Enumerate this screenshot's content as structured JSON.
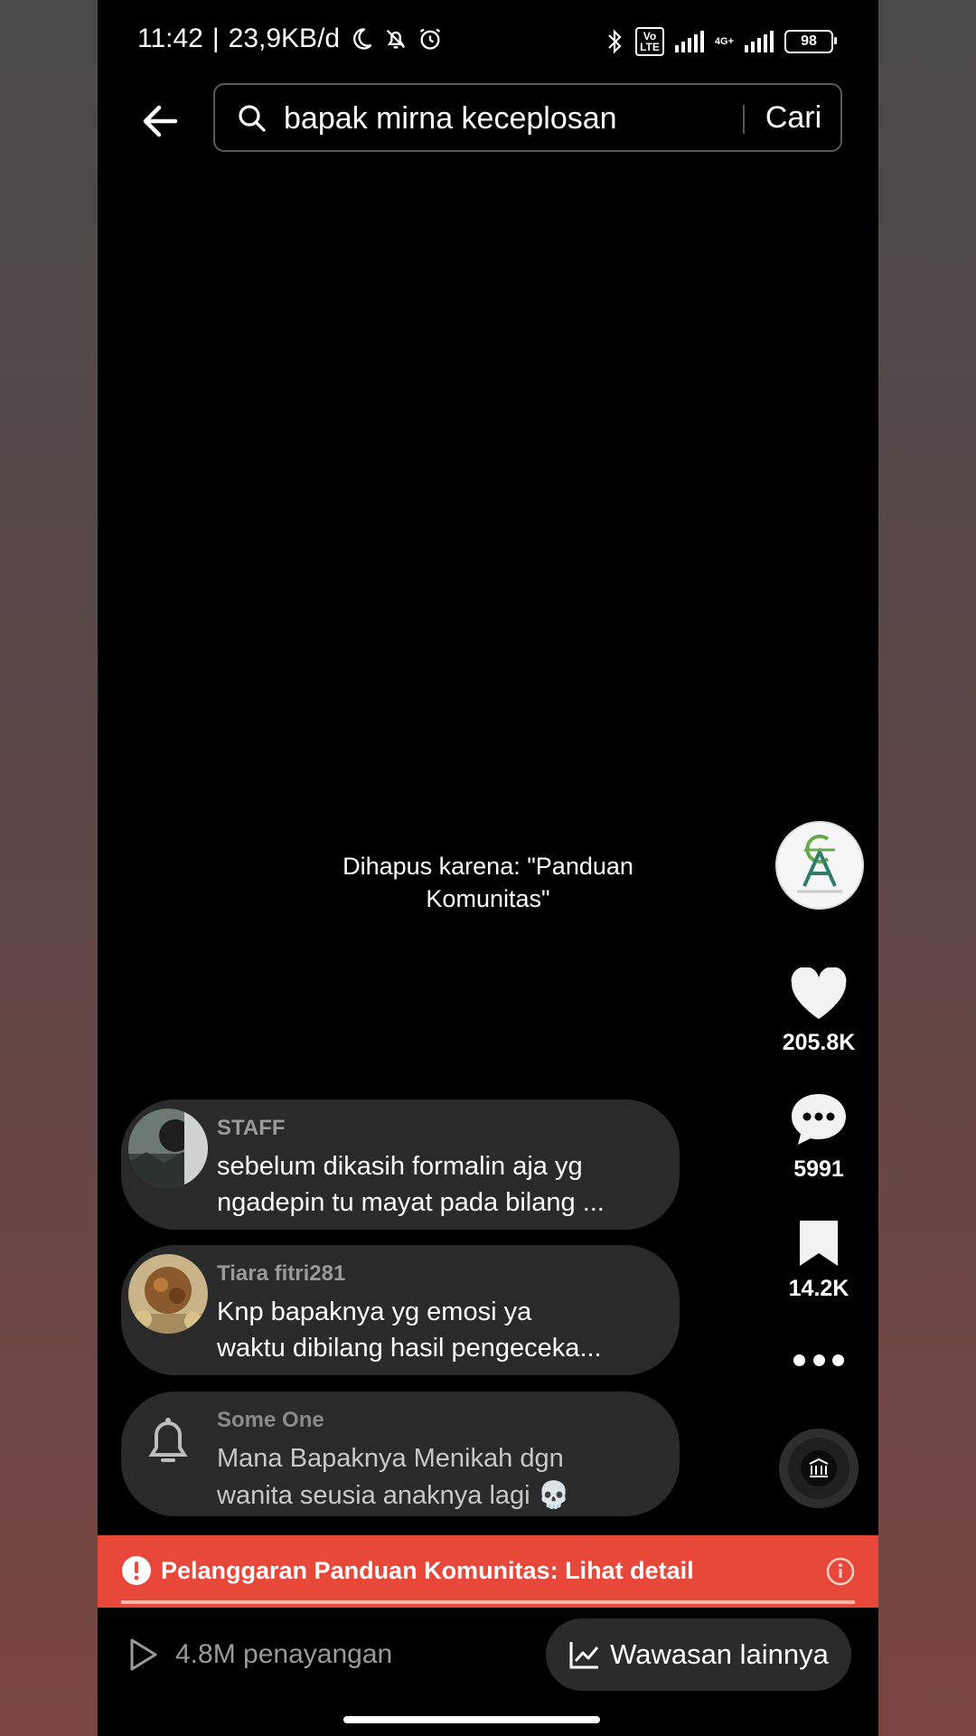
{
  "status_bar": {
    "time": "11:42",
    "separator": "|",
    "net_speed": "23,9KB/d",
    "volte": "Vo\nLTE",
    "network": "4G+",
    "battery": "98"
  },
  "search": {
    "query": "bapak mirna keceplosan",
    "button_label": "Cari"
  },
  "video": {
    "removed_notice": "Dihapus karena: \"Panduan Komunitas\""
  },
  "actions": {
    "likes": "205.8K",
    "comments": "5991",
    "saves": "14.2K"
  },
  "comments": [
    {
      "user": "STAFF",
      "line1": "sebelum dikasih formalin aja yg",
      "line2": "ngadepin tu mayat pada bilang ..."
    },
    {
      "user": "Tiara fitri281",
      "line1": "Knp bapaknya yg emosi ya",
      "line2": "waktu dibilang hasil pengeceka..."
    },
    {
      "user": "Some One",
      "line1": "Mana Bapaknya Menikah dgn",
      "line2": "wanita seusia anaknya lagi 💀"
    }
  ],
  "violation": {
    "text": "Pelanggaran Panduan Komunitas: Lihat detail",
    "progress": 1.0
  },
  "footer": {
    "views": "4.8M penayangan",
    "insights_label": "Wawasan lainnya"
  },
  "colors": {
    "violation_red": "#e8483a",
    "bubble_bg": "#2a2a2a"
  }
}
